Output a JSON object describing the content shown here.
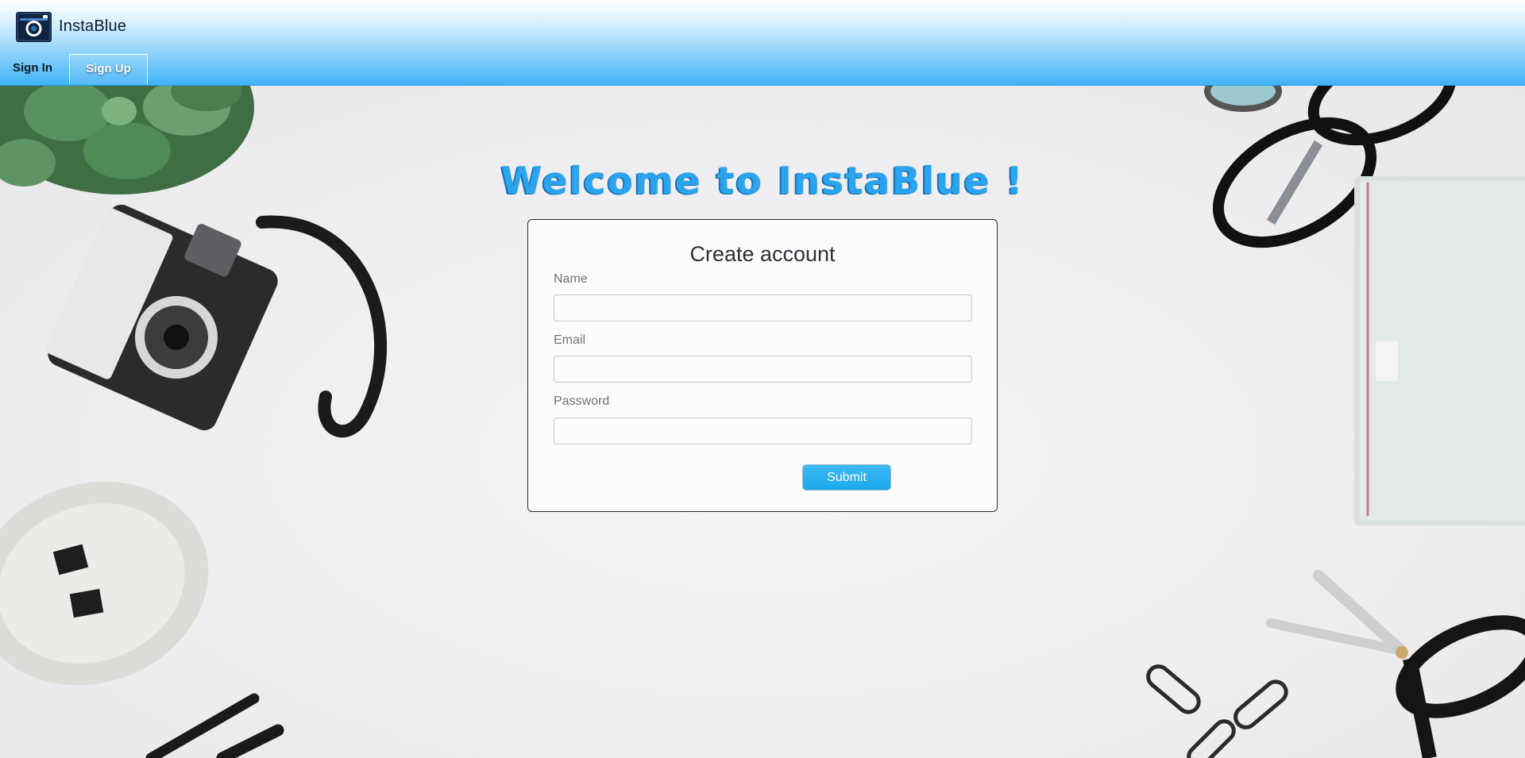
{
  "app": {
    "name": "InstaBlue"
  },
  "nav": {
    "signin_label": "Sign In",
    "signup_label": "Sign Up",
    "active": "Sign Up"
  },
  "main": {
    "welcome_text": "Welcome to InstaBlue !"
  },
  "form": {
    "title": "Create account",
    "name": {
      "label": "Name",
      "value": "",
      "placeholder": ""
    },
    "email": {
      "label": "Email",
      "value": "",
      "placeholder": ""
    },
    "password": {
      "label": "Password",
      "value": "",
      "placeholder": ""
    },
    "submit_label": "Submit"
  },
  "colors": {
    "accent": "#2aa4ee",
    "header_top": "#ffffff",
    "header_bottom": "#3fb2f7",
    "submit": "#1aa8ea"
  },
  "icons": {
    "logo": "camera-logo-icon"
  }
}
